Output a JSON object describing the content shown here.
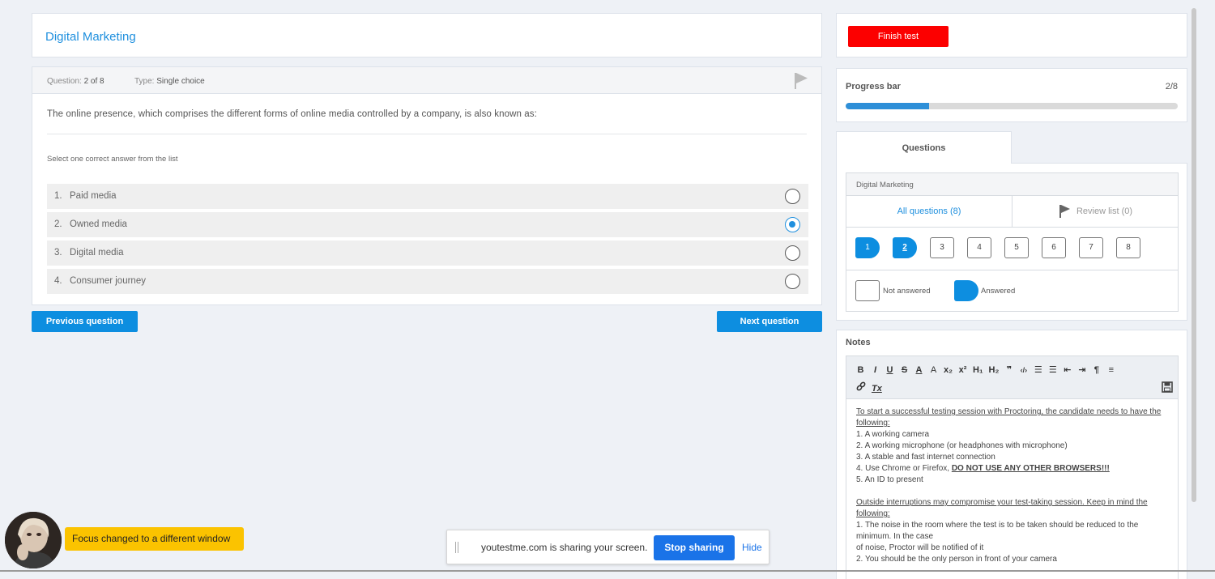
{
  "test": {
    "title": "Digital Marketing"
  },
  "question": {
    "number_label": "Question:",
    "number_value": "2 of 8",
    "type_label": "Type:",
    "type_value": "Single choice",
    "text": "The online presence, which comprises the different forms of online media controlled by a company, is also known as:",
    "hint": "Select one correct answer from the list",
    "answers": [
      {
        "num": "1.",
        "label": "Paid media",
        "checked": false
      },
      {
        "num": "2.",
        "label": "Owned media",
        "checked": true
      },
      {
        "num": "3.",
        "label": "Digital media",
        "checked": false
      },
      {
        "num": "4.",
        "label": "Consumer journey",
        "checked": false
      }
    ]
  },
  "nav": {
    "prev_label": "Previous question",
    "next_label": "Next question"
  },
  "finish": {
    "label": "Finish test",
    "color": "#fc0000"
  },
  "progress": {
    "label": "Progress bar",
    "count": "2/8",
    "fraction": 0.25
  },
  "questions_panel": {
    "tab_label": "Questions",
    "section": "Digital Marketing",
    "all_label": "All questions (8)",
    "review_label": "Review list (0)",
    "numbers": [
      "1",
      "2",
      "3",
      "4",
      "5",
      "6",
      "7",
      "8"
    ],
    "answered": [
      true,
      true,
      false,
      false,
      false,
      false,
      false,
      false
    ],
    "current": 2,
    "legend_not_answered": "Not answered",
    "legend_answered": "Answered"
  },
  "notes": {
    "label": "Notes",
    "toolbar_row1": [
      "B",
      "I",
      "U",
      "S",
      "A",
      "A",
      "x₂",
      "x²",
      "H₁",
      "H₂",
      "❞",
      "‹/›",
      "☰",
      "☰",
      "⇤",
      "⇥",
      "¶",
      "≡"
    ],
    "toolbar_row2_clear": "Tx",
    "para1_heading": "To start a successful testing session with Proctoring, the candidate needs to have the following:",
    "items1": [
      "1. A working camera",
      "2. A working microphone (or headphones with microphone)",
      "3. A stable and fast internet connection",
      "4. Use Chrome or Firefox, ",
      "5. An ID to present"
    ],
    "browsers_warning": "DO NOT USE ANY OTHER BROWSERS!!!",
    "para2_heading": "Outside interruptions may compromise your test-taking session. Keep in mind the following:",
    "items2": [
      "1. The noise in the room where the test is to be taken should be reduced to the minimum. In the case",
      "of noise, Proctor will be notified of it",
      "2. You should be the only person in front of your camera"
    ]
  },
  "proctor": {
    "focus_message": "Focus changed to a different window"
  },
  "share_bar": {
    "message": "youtestme.com is sharing your screen.",
    "stop_label": "Stop sharing",
    "hide_label": "Hide"
  },
  "colors": {
    "accent": "#0d8ee0",
    "warning": "#fbc300"
  }
}
